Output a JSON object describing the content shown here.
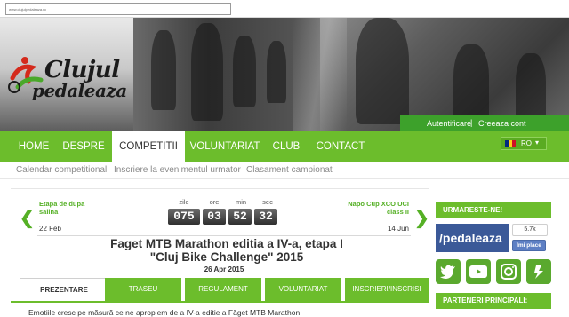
{
  "browser": {
    "url": "www.clujulpedaleaza.ro"
  },
  "site": {
    "logo_line1": "Clujul",
    "logo_line2": "pedaleaza"
  },
  "auth": {
    "login": "Autentificare",
    "separator": "|",
    "register": "Creeaza cont"
  },
  "nav": {
    "items": [
      "HOME",
      "DESPRE",
      "COMPETITII",
      "VOLUNTARIAT",
      "CLUB",
      "CONTACT"
    ],
    "active": "COMPETITII",
    "language": "RO"
  },
  "subnav": [
    "Calendar competitional",
    "Inscriere la evenimentul urmator",
    "Clasament campionat"
  ],
  "countdown": {
    "labels": {
      "days": "zile",
      "hours": "ore",
      "minutes": "min",
      "seconds": "sec"
    },
    "values": {
      "days": "075",
      "hours": "03",
      "minutes": "52",
      "seconds": "32"
    }
  },
  "prev_event": {
    "name": "Etapa de dupa salina",
    "date": "22 Feb"
  },
  "next_event": {
    "name": "Napo Cup XCO UCI class II",
    "date": "14 Jun"
  },
  "event": {
    "title": "Faget MTB Marathon editia a IV-a, etapa I \"Cluj Bike Challenge\" 2015",
    "date": "26 Apr 2015"
  },
  "tabs": [
    "PREZENTARE",
    "TRASEU",
    "REGULAMENT",
    "VOLUNTARIAT",
    "INSCRIERI/INSCRISI"
  ],
  "body_text": "Emotiile cresc pe măsură ce ne apropiem de a IV-a editie a Făget MTB Marathon.",
  "sidebar": {
    "follow_title": "URMARESTE-NE!",
    "facebook_name": "/pedaleaza",
    "like_count": "5.7k",
    "like_label": "Îmi place",
    "partners_title": "PARTENERI PRINCIPALI:",
    "social_icons": [
      "twitter-icon",
      "youtube-icon",
      "instagram-icon",
      "strava-icon"
    ]
  },
  "colors": {
    "green": "#6cbd2c",
    "dark_green": "#3da12b",
    "facebook": "#3b5998"
  }
}
